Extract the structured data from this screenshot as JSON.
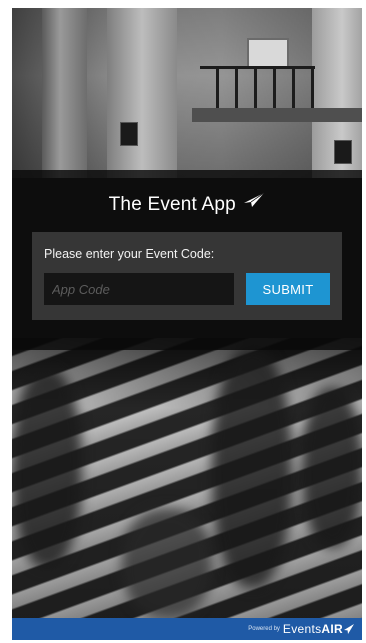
{
  "app": {
    "title": "The Event App",
    "title_icon": "paper-plane-icon"
  },
  "form": {
    "label": "Please enter your Event Code:",
    "code_placeholder": "App Code",
    "code_value": "",
    "submit_label": "SUBMIT"
  },
  "footer": {
    "powered_label": "Powered by",
    "brand_light": "Events",
    "brand_bold": "AIR",
    "brand_icon": "paper-plane-icon"
  },
  "colors": {
    "accent": "#1e95d2",
    "footer": "#1f5aa6"
  }
}
